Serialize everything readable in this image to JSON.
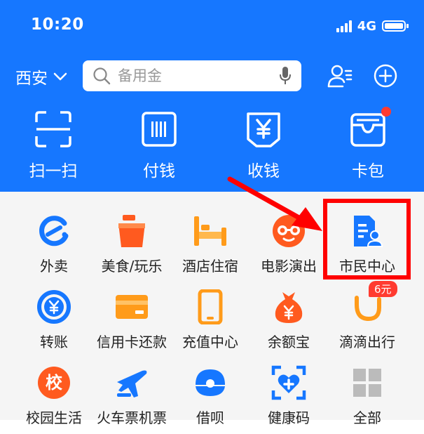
{
  "status_bar": {
    "time": "10:20",
    "network": "4G"
  },
  "header": {
    "city": "西安",
    "search": {
      "placeholder": "备用金"
    }
  },
  "quick_actions": [
    {
      "label": "扫一扫",
      "icon": "scan-icon"
    },
    {
      "label": "付钱",
      "icon": "barcode-icon"
    },
    {
      "label": "收钱",
      "icon": "yuan-receive-icon"
    },
    {
      "label": "卡包",
      "icon": "wallet-icon"
    }
  ],
  "services": [
    {
      "label": "外卖",
      "icon": "eleme-icon",
      "color": "#1677ff"
    },
    {
      "label": "美食/玩乐",
      "icon": "cup-icon",
      "color": "#ff5a1f"
    },
    {
      "label": "酒店住宿",
      "icon": "bed-icon",
      "color": "#ff9b1a"
    },
    {
      "label": "电影演出",
      "icon": "glasses-icon",
      "color": "#ff5a1f"
    },
    {
      "label": "市民中心",
      "icon": "citizen-id-icon",
      "color": "#1677ff"
    },
    {
      "label": "转账",
      "icon": "transfer-icon",
      "color": "#1677ff"
    },
    {
      "label": "信用卡还款",
      "icon": "credit-card-icon",
      "color": "#ff9b1a"
    },
    {
      "label": "充值中心",
      "icon": "phone-icon",
      "color": "#ff9b1a"
    },
    {
      "label": "余额宝",
      "icon": "money-bag-icon",
      "color": "#ff5a1f"
    },
    {
      "label": "滴滴出行",
      "icon": "didi-icon",
      "color": "#ff9b1a"
    },
    {
      "label": "校园生活",
      "icon": "school-icon",
      "color": "#ff5a1f"
    },
    {
      "label": "火车票机票",
      "icon": "plane-icon",
      "color": "#1677ff"
    },
    {
      "label": "借呗",
      "icon": "jiebei-icon",
      "color": "#1677ff"
    },
    {
      "label": "健康码",
      "icon": "health-code-icon",
      "color": "#1677ff"
    },
    {
      "label": "全部",
      "icon": "grid-icon",
      "color": "#bbbbbb"
    }
  ],
  "didi_badge": "6元",
  "school_glyph": "校",
  "colors": {
    "brand": "#1677ff",
    "annotation": "#ff0000"
  }
}
